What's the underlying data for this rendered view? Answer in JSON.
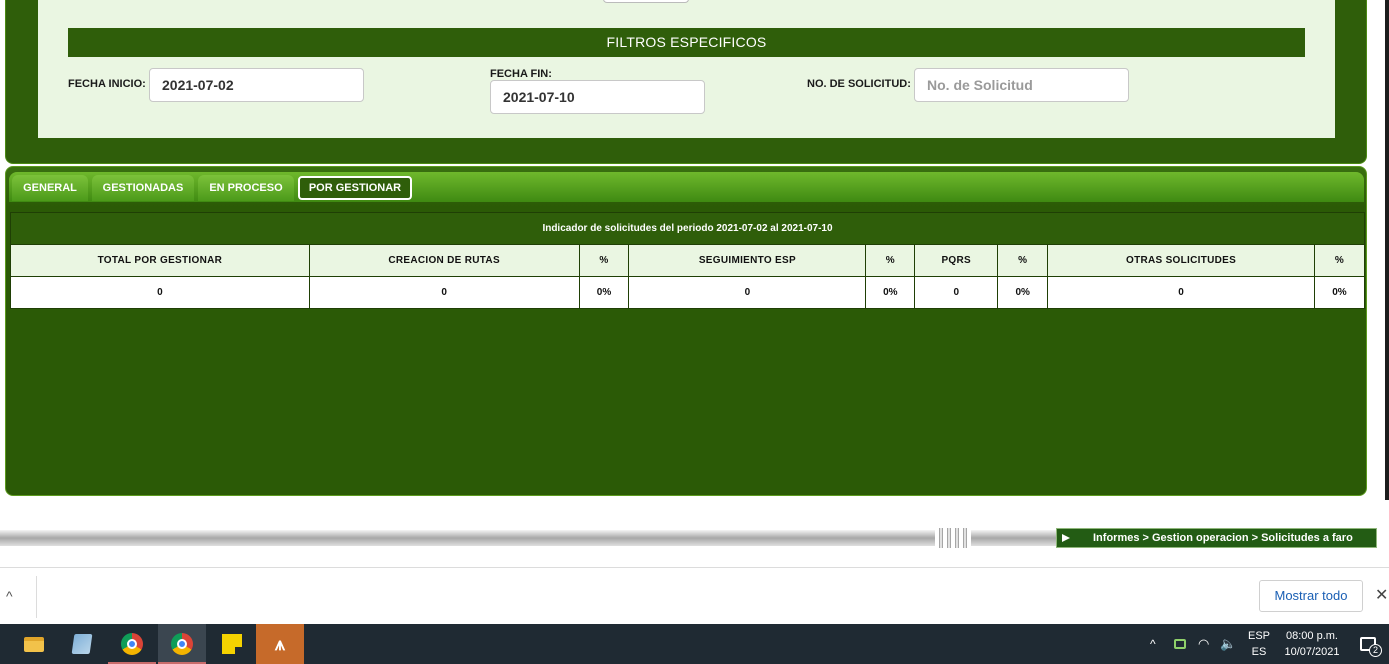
{
  "filters": {
    "header": "FILTROS ESPECIFICOS",
    "fecha_inicio_label": "FECHA INICIO:",
    "fecha_inicio_value": "2021-07-02",
    "fecha_fin_label": "FECHA FIN:",
    "fecha_fin_value": "2021-07-10",
    "solicitud_label": "NO. DE SOLICITUD:",
    "solicitud_placeholder": "No. de Solicitud"
  },
  "tabs": [
    {
      "label": "GENERAL",
      "active": false
    },
    {
      "label": "GESTIONADAS",
      "active": false
    },
    {
      "label": "EN PROCESO",
      "active": false
    },
    {
      "label": "POR GESTIONAR",
      "active": true
    }
  ],
  "indicator": {
    "title": "Indicador de solicitudes del periodo 2021-07-02 al 2021-07-10",
    "headers": [
      "TOTAL POR GESTIONAR",
      "CREACION DE RUTAS",
      "%",
      "SEGUIMIENTO ESP",
      "%",
      "PQRS",
      "%",
      "OTRAS SOLICITUDES",
      "%"
    ],
    "values": [
      "0",
      "0",
      "0%",
      "0",
      "0%",
      "0",
      "0%",
      "0",
      "0%"
    ]
  },
  "breadcrumb": "Informes > Gestion operacion > Solicitudes a faro",
  "download_bar": {
    "show_all": "Mostrar todo",
    "close_glyph": "✕",
    "chevron_glyph": "^"
  },
  "taskbar": {
    "apps": [
      "file-explorer-icon",
      "notes-icon",
      "chrome-icon",
      "chrome-profile-icon",
      "sticky-notes-icon",
      "custom-app-icon"
    ],
    "caret": "^",
    "lang_top": "ESP",
    "lang_bottom": "ES",
    "time": "08:00 p.m.",
    "date": "10/07/2021",
    "notifications": "2"
  },
  "colors": {
    "dark_green": "#2f5e0a",
    "light_green_bg": "#eaf6e2",
    "tab_green": "#6fb82c",
    "link_blue": "#1a5fb4"
  }
}
